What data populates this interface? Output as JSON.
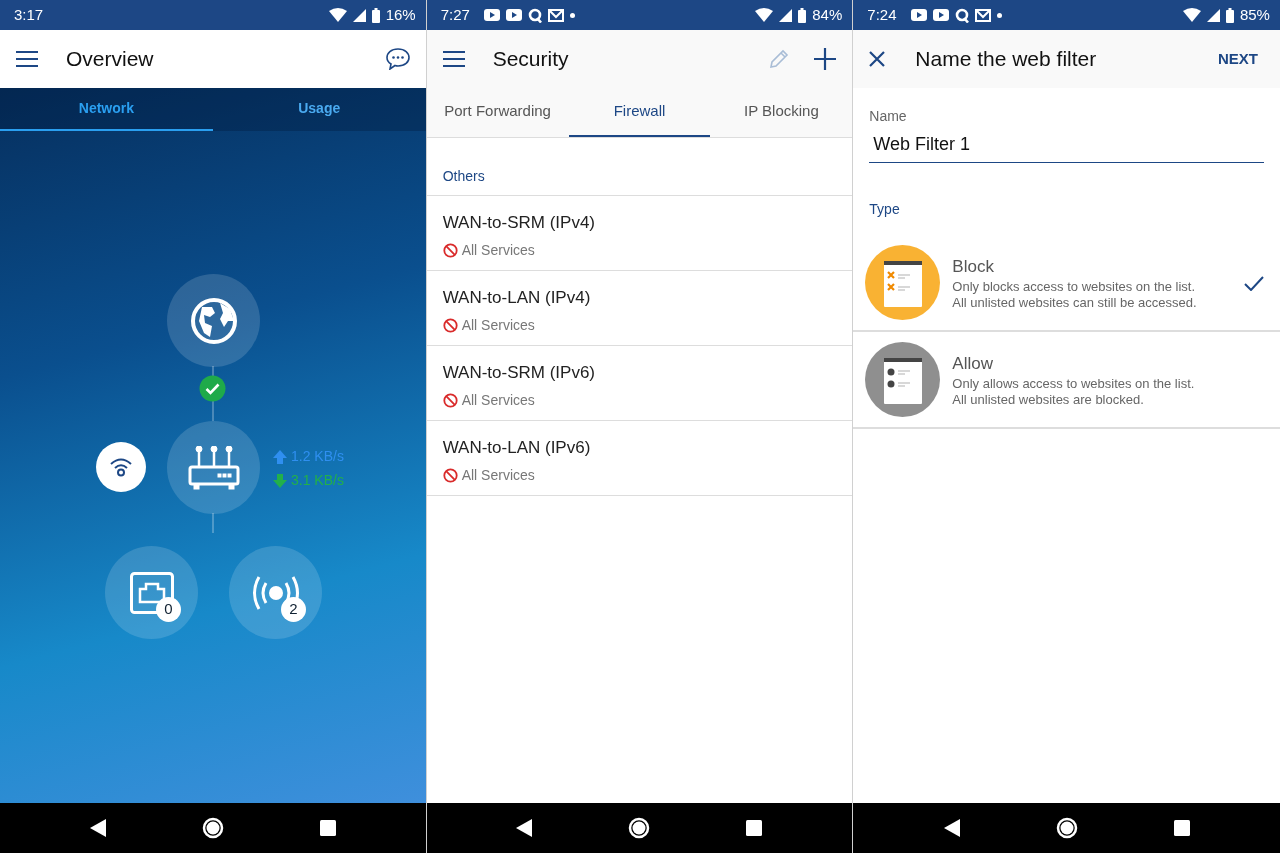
{
  "screens": [
    {
      "kind": "overview",
      "status_bar": {
        "time": "3:17",
        "battery": "16%"
      },
      "title": "Overview",
      "tabs": [
        {
          "label": "Network",
          "selected": true
        },
        {
          "label": "Usage",
          "selected": false
        }
      ],
      "diagram": {
        "internet_ok": true,
        "upload": "1.2 KB/s",
        "download": "3.1 KB/s",
        "wired_count": "0",
        "wireless_count": "2"
      }
    },
    {
      "kind": "security",
      "status_bar": {
        "time": "7:27",
        "notifications": [
          {
            "kind": "video"
          },
          {
            "kind": "video"
          },
          {
            "kind": "q"
          },
          {
            "kind": "mail"
          },
          {
            "kind": "dot"
          }
        ],
        "battery": "84%"
      },
      "title": "Security",
      "actions": [
        {
          "kind": "edit",
          "disabled": true
        },
        {
          "kind": "add",
          "disabled": false
        }
      ],
      "tabs": [
        {
          "label": "Port Forwarding",
          "selected": false
        },
        {
          "label": "Firewall",
          "selected": true
        },
        {
          "label": "IP Blocking",
          "selected": false
        }
      ],
      "section": "Others",
      "rules": [
        {
          "name": "WAN-to-SRM (IPv4)",
          "services": "All Services"
        },
        {
          "name": "WAN-to-LAN (IPv4)",
          "services": "All Services"
        },
        {
          "name": "WAN-to-SRM (IPv6)",
          "services": "All Services"
        },
        {
          "name": "WAN-to-LAN (IPv6)",
          "services": "All Services"
        }
      ]
    },
    {
      "kind": "filter",
      "status_bar": {
        "time": "7:24",
        "notifications": [
          {
            "kind": "video"
          },
          {
            "kind": "video"
          },
          {
            "kind": "q"
          },
          {
            "kind": "mail"
          },
          {
            "kind": "dot"
          }
        ],
        "battery": "85%"
      },
      "title": "Name the web filter",
      "next": "NEXT",
      "field": {
        "label": "Name",
        "value": "Web Filter 1"
      },
      "section": "Type",
      "options": [
        {
          "kind": "block",
          "title": "Block",
          "description": "Only blocks access to websites on the list. All unlisted websites can still be accessed.",
          "selected": true
        },
        {
          "kind": "allow",
          "title": "Allow",
          "description": "Only allows access to websites on the list. All unlisted websites are blocked.",
          "selected": false
        }
      ]
    }
  ]
}
